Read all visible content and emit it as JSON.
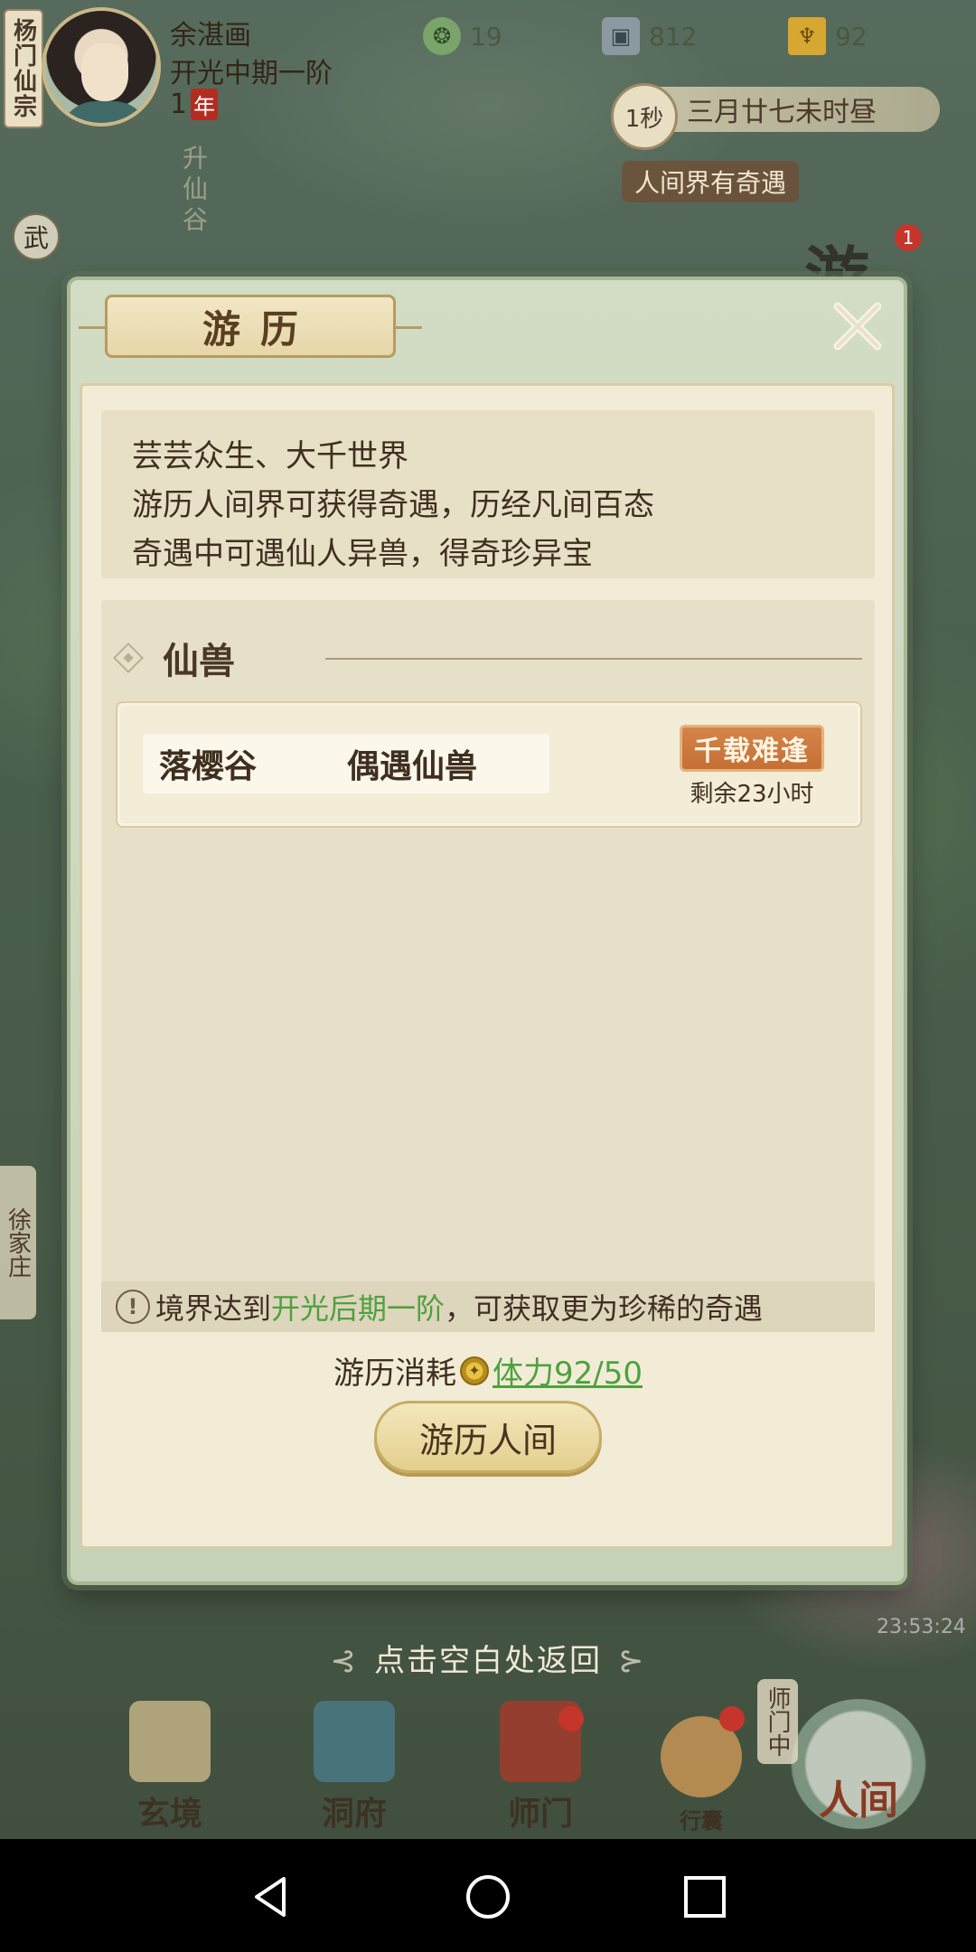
{
  "hud": {
    "sect": "杨门仙宗",
    "player_name": "余湛画",
    "realm": "开光中期一阶",
    "age": "1",
    "age_unit": "年",
    "resources": [
      {
        "icon": "jade-swirl-icon",
        "value": "19"
      },
      {
        "icon": "coin-icon",
        "value": "812"
      },
      {
        "icon": "gold-ingot-icon",
        "value": "92"
      }
    ],
    "time_unit": "1秒",
    "date_text": "三月廿七未时昼",
    "event_text": "人间界有奇遇",
    "map_vertical_text": "升仙谷",
    "wu_badge": "武",
    "you_badge": "游",
    "you_badge_count": "1",
    "left_village": "徐家庄",
    "map_time": "23:53:24"
  },
  "modal": {
    "title": "游历",
    "intro_lines": [
      "芸芸众生、大千世界",
      "游历人间界可获得奇遇，历经凡间百态",
      "奇遇中可遇仙人异兽，得奇珍异宝"
    ],
    "section_title": "仙兽",
    "encounter": {
      "place": "落樱谷",
      "type": "偶遇仙兽",
      "rarity": "千载难逢",
      "time_left": "剩余23小时"
    },
    "notice": {
      "prefix": "境界达到",
      "highlight": "开光后期一阶",
      "suffix": "，可获取更为珍稀的奇遇"
    },
    "cost_label": "游历消耗",
    "stamina_text": "体力92/50",
    "action_button": "游历人间",
    "return_hint": "点击空白处返回"
  },
  "bottom_nav": [
    {
      "label": "玄境",
      "icon": "scroll-icon"
    },
    {
      "label": "洞府",
      "icon": "pavilion-icon"
    },
    {
      "label": "师门",
      "icon": "banner-icon"
    },
    {
      "label": "行囊",
      "icon": "bag-icon"
    },
    {
      "label": "人间",
      "icon": "landscape-icon"
    }
  ],
  "shimen_status": "师门中",
  "colors": {
    "highlight_green": "#4ea13f",
    "rarity_orange": "#c56f35",
    "badge_red": "#c6352b"
  }
}
